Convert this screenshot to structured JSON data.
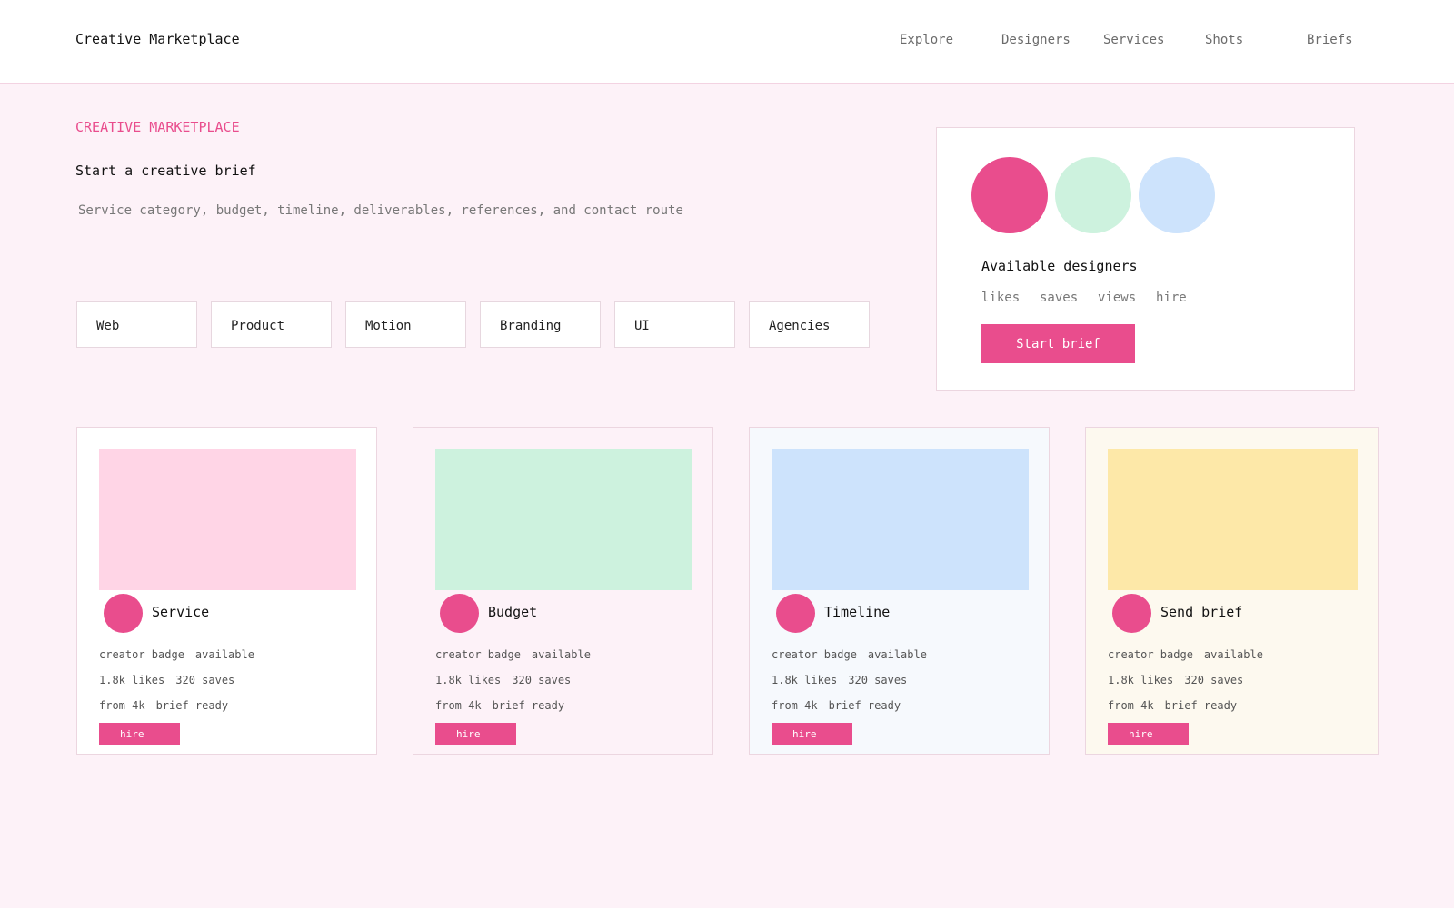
{
  "header": {
    "brand": "Creative Marketplace",
    "nav": [
      "Explore",
      "Designers",
      "Services",
      "Shots",
      "Briefs"
    ]
  },
  "hero": {
    "eyebrow": "CREATIVE MARKETPLACE",
    "title": "Start a creative brief",
    "subtitle": "Service category, budget, timeline, deliverables, references, and contact route"
  },
  "categories": [
    "Web",
    "Product",
    "Motion",
    "Branding",
    "UI",
    "Agencies"
  ],
  "side_panel": {
    "title": "Available designers",
    "meta": [
      "likes",
      "saves",
      "views",
      "hire"
    ],
    "button": "Start brief",
    "avatar_colors": [
      "#e94d8d",
      "#cdf2de",
      "#cde3fc"
    ]
  },
  "cards": [
    {
      "title": "Service",
      "badge": "creator badge",
      "status": "available",
      "likes": "1.8k likes",
      "saves": "320 saves",
      "price": "from 4k",
      "ready": "brief ready",
      "button": "hire",
      "thumb_color": "#ffd5e6",
      "bg_color": "#ffffff"
    },
    {
      "title": "Budget",
      "badge": "creator badge",
      "status": "available",
      "likes": "1.8k likes",
      "saves": "320 saves",
      "price": "from 4k",
      "ready": "brief ready",
      "button": "hire",
      "thumb_color": "#cdf2de",
      "bg_color": "#fdf2f8"
    },
    {
      "title": "Timeline",
      "badge": "creator badge",
      "status": "available",
      "likes": "1.8k likes",
      "saves": "320 saves",
      "price": "from 4k",
      "ready": "brief ready",
      "button": "hire",
      "thumb_color": "#cde3fc",
      "bg_color": "#f6f9fd"
    },
    {
      "title": "Send brief",
      "badge": "creator badge",
      "status": "available",
      "likes": "1.8k likes",
      "saves": "320 saves",
      "price": "from 4k",
      "ready": "brief ready",
      "button": "hire",
      "thumb_color": "#fde8a8",
      "bg_color": "#fdf9ef"
    }
  ],
  "colors": {
    "accent": "#e94d8d",
    "page_bg": "#fdf2f8"
  }
}
